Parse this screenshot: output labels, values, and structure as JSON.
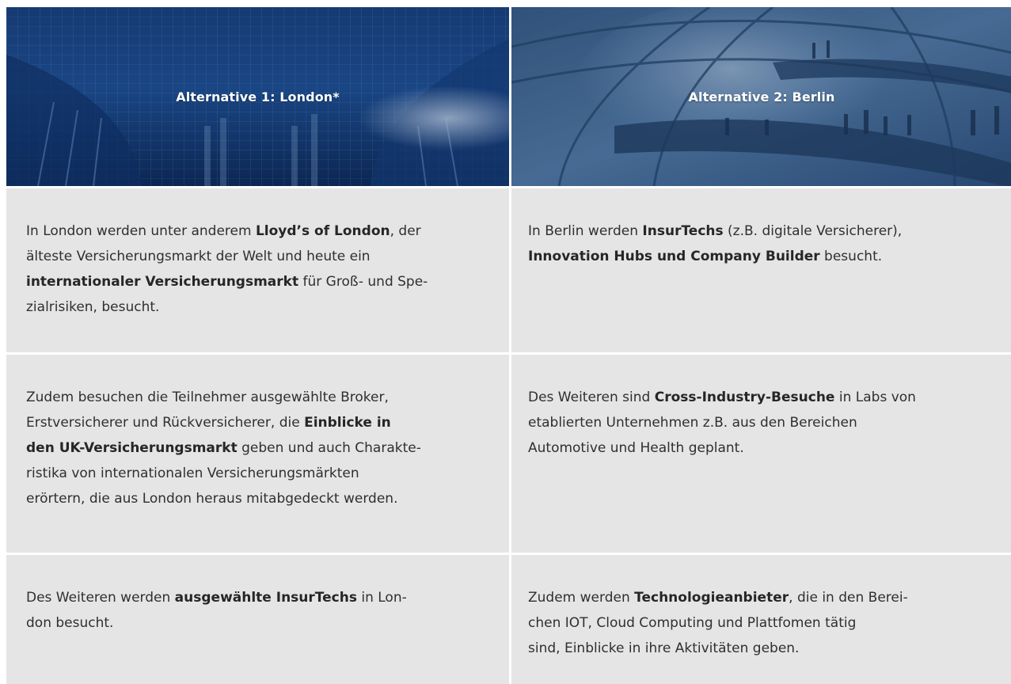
{
  "headers": {
    "london": "Alternative 1: London*",
    "berlin": "Alternative 2: Berlin"
  },
  "rows": [
    {
      "left": [
        [
          {
            "t": "In London werden unter anderem "
          },
          {
            "t": "Lloyd’s of London",
            "b": true
          },
          {
            "t": ", der"
          }
        ],
        [
          {
            "t": "älteste Versicherungsmarkt der Welt und heute ein"
          }
        ],
        [
          {
            "t": "internationaler Versicherungsmarkt",
            "b": true
          },
          {
            "t": " für Groß- und Spe-"
          }
        ],
        [
          {
            "t": "zialrisiken, besucht."
          }
        ]
      ],
      "right": [
        [
          {
            "t": "In Berlin werden "
          },
          {
            "t": "InsurTechs",
            "b": true
          },
          {
            "t": " (z.B. digitale Versicherer),"
          }
        ],
        [
          {
            "t": "Innovation Hubs und Company Builder",
            "b": true
          },
          {
            "t": " besucht."
          }
        ]
      ]
    },
    {
      "left": [
        [
          {
            "t": "Zudem besuchen die Teilnehmer ausgewählte Broker,"
          }
        ],
        [
          {
            "t": "Erstversicherer und Rückversicherer, die "
          },
          {
            "t": "Einblicke in",
            "b": true
          }
        ],
        [
          {
            "t": "den UK-Versicherungsmarkt",
            "b": true
          },
          {
            "t": " geben und auch Charakte-"
          }
        ],
        [
          {
            "t": "ristika von internationalen Versicherungsmärkten"
          }
        ],
        [
          {
            "t": "erörtern, die aus London heraus mitabgedeckt werden."
          }
        ]
      ],
      "right": [
        [
          {
            "t": "Des Weiteren sind "
          },
          {
            "t": "Cross-Industry-Besuche",
            "b": true
          },
          {
            "t": " in Labs von"
          }
        ],
        [
          {
            "t": "etablierten Unternehmen z.B. aus den Bereichen"
          }
        ],
        [
          {
            "t": "Automotive und Health geplant."
          }
        ]
      ]
    },
    {
      "left": [
        [
          {
            "t": "Des Weiteren werden "
          },
          {
            "t": "ausgewählte InsurTechs",
            "b": true
          },
          {
            "t": " in Lon-"
          }
        ],
        [
          {
            "t": "don besucht."
          }
        ]
      ],
      "right": [
        [
          {
            "t": "Zudem werden "
          },
          {
            "t": "Technologieanbieter",
            "b": true
          },
          {
            "t": ", die in den Berei-"
          }
        ],
        [
          {
            "t": "chen IOT, Cloud Computing und Plattfomen tätig"
          }
        ],
        [
          {
            "t": "sind, Einblicke in ihre Aktivitäten geben."
          }
        ]
      ]
    }
  ]
}
